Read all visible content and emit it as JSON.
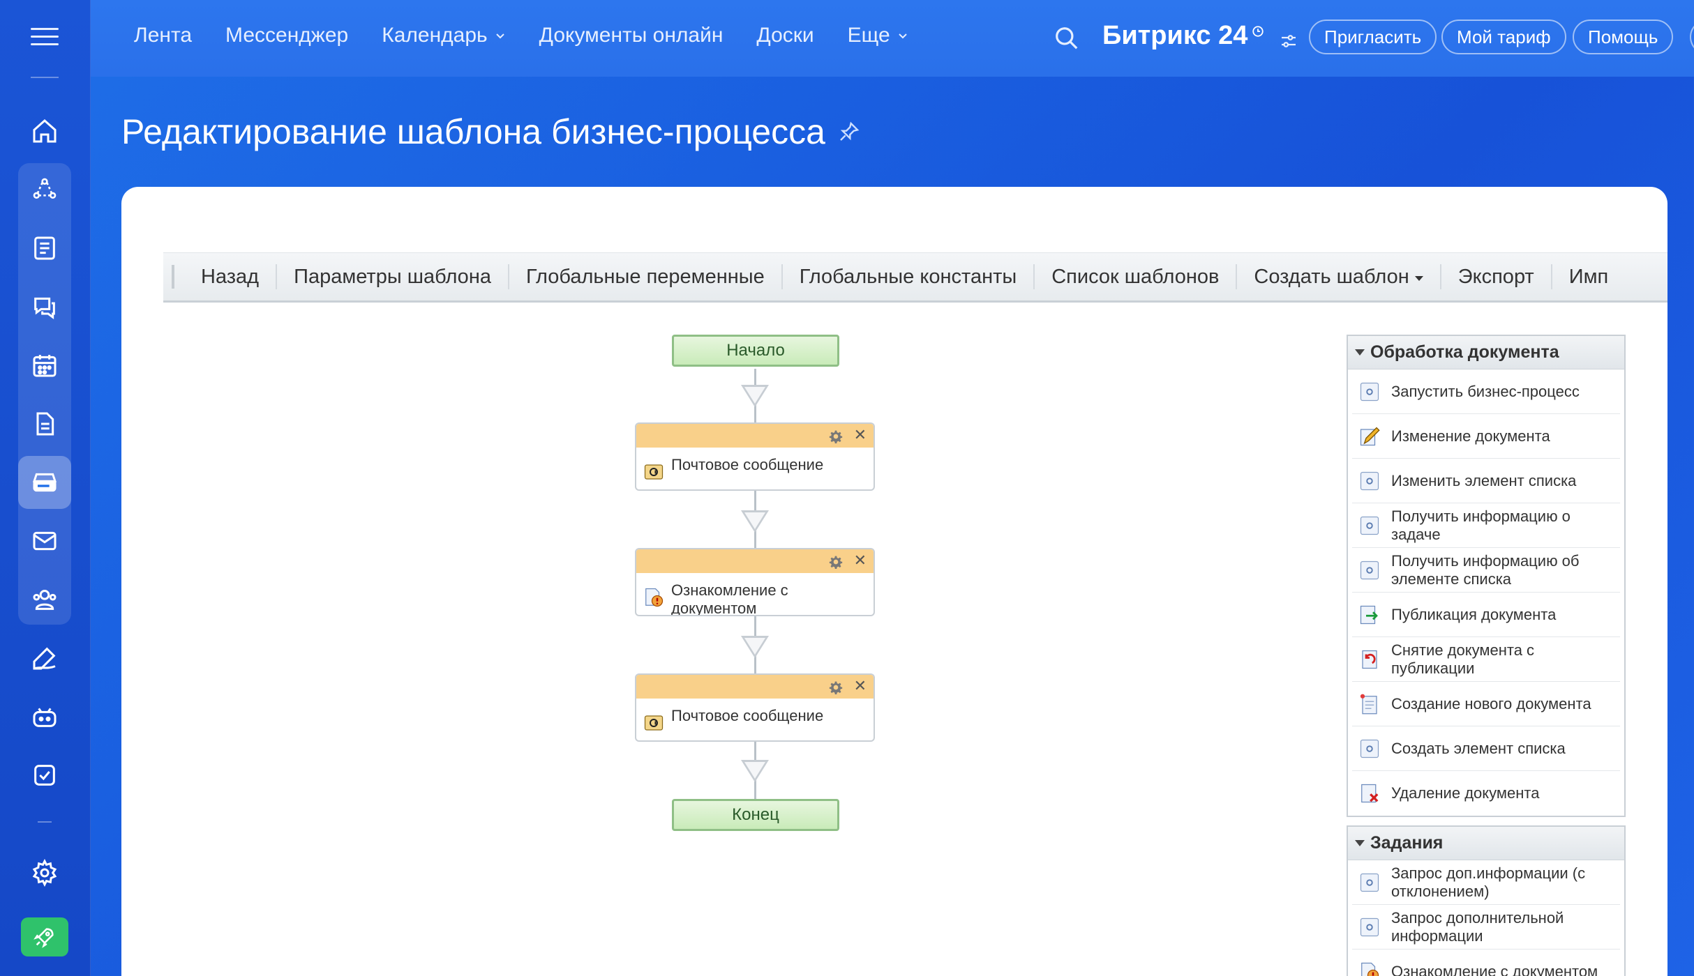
{
  "topnav": {
    "items": [
      "Лента",
      "Мессенджер",
      "Календарь",
      "Документы онлайн",
      "Доски",
      "Еще"
    ],
    "brand": "Битрикс 24",
    "invite": "Пригласить",
    "tariff": "Мой тариф",
    "help": "Помощь"
  },
  "page": {
    "title": "Редактирование шаблона бизнес-процесса"
  },
  "toolbar": {
    "back": "Назад",
    "params": "Параметры шаблона",
    "global_vars": "Глобальные переменные",
    "global_consts": "Глобальные константы",
    "templates_list": "Список шаблонов",
    "create_template": "Создать шаблон",
    "export": "Экспорт",
    "import": "Имп"
  },
  "workflow": {
    "start": "Начало",
    "end": "Конец",
    "activities": [
      {
        "label": "Почтовое сообщение",
        "icon": "mail-icon"
      },
      {
        "label": "Ознакомление с документом",
        "icon": "review-icon"
      },
      {
        "label": "Почтовое сообщение",
        "icon": "mail-icon"
      }
    ]
  },
  "panel": {
    "sections": [
      {
        "title": "Обработка документа",
        "items": [
          {
            "label": "Запустить бизнес-процесс",
            "icon": "generic-activity-icon"
          },
          {
            "label": "Изменение документа",
            "icon": "edit-document-icon"
          },
          {
            "label": "Изменить элемент списка",
            "icon": "generic-activity-icon"
          },
          {
            "label": "Получить информацию о задаче",
            "icon": "generic-activity-icon"
          },
          {
            "label": "Получить информацию об элементе списка",
            "icon": "generic-activity-icon"
          },
          {
            "label": "Публикация документа",
            "icon": "publish-icon"
          },
          {
            "label": "Снятие документа с публикации",
            "icon": "unpublish-icon"
          },
          {
            "label": "Создание нового документа",
            "icon": "new-document-icon"
          },
          {
            "label": "Создать элемент списка",
            "icon": "generic-activity-icon"
          },
          {
            "label": "Удаление документа",
            "icon": "delete-document-icon"
          }
        ]
      },
      {
        "title": "Задания",
        "items": [
          {
            "label": "Запрос доп.информации (с отклонением)",
            "icon": "generic-activity-icon"
          },
          {
            "label": "Запрос дополнительной информации",
            "icon": "generic-activity-icon"
          },
          {
            "label": "Ознакомление с документом",
            "icon": "review-icon"
          }
        ]
      }
    ]
  },
  "colors": {
    "accent": "#1f6fe8",
    "activity_header": "#f9d08a",
    "terminal": "#c9ebb9",
    "rocket": "#2fc26b"
  }
}
